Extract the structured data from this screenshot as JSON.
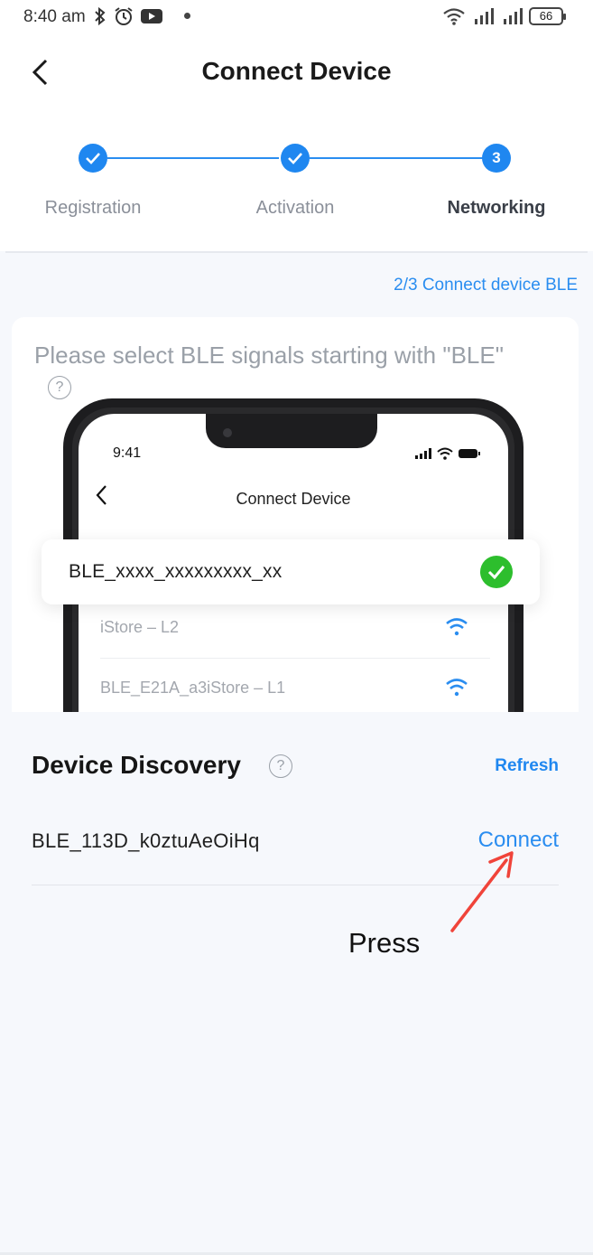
{
  "status_bar": {
    "time": "8:40 am",
    "battery": "66",
    "icons_left": [
      "bluetooth-icon",
      "alarm-icon",
      "youtube-icon"
    ],
    "icons_right": [
      "wifi-icon",
      "signal-icon",
      "signal-icon"
    ]
  },
  "header": {
    "title": "Connect Device"
  },
  "stepper": {
    "steps": [
      {
        "label": "Registration",
        "state": "done"
      },
      {
        "label": "Activation",
        "state": "done"
      },
      {
        "label": "Networking",
        "state": "current",
        "number": "3"
      }
    ]
  },
  "progress_text": "2/3 Connect device BLE",
  "instruction_card": {
    "title": "Please select BLE signals starting with \"BLE\"",
    "help": "?",
    "phone": {
      "time": "9:41",
      "title": "Connect Device",
      "selected_network": "BLE_xxxx_xxxxxxxxx_xx",
      "networks": [
        {
          "name": "iStore – L2"
        },
        {
          "name": "BLE_E21A_a3iStore – L1"
        }
      ]
    }
  },
  "discovery": {
    "title": "Device Discovery",
    "help": "?",
    "refresh_label": "Refresh",
    "devices": [
      {
        "name": "BLE_113D_k0ztuAeOiHq",
        "action": "Connect"
      }
    ]
  },
  "annotation": {
    "text": "Press",
    "color": "#f0443a"
  },
  "colors": {
    "accent": "#1f87f0",
    "success": "#2dbe2d"
  }
}
